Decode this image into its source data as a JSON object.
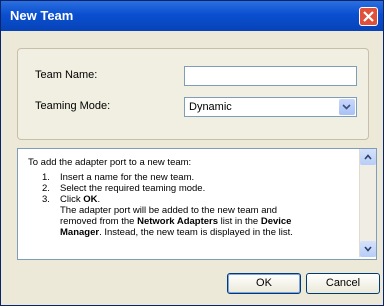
{
  "window": {
    "title": "New Team"
  },
  "form": {
    "team_name_label": "Team Name:",
    "team_name_value": "",
    "teaming_mode_label": "Teaming Mode:",
    "teaming_mode_value": "Dynamic"
  },
  "info": {
    "intro": "To add the adapter port to a new team:",
    "steps": [
      {
        "num": "1.",
        "text": "Insert a name for the new team."
      },
      {
        "num": "2.",
        "text": "Select the required teaming mode."
      },
      {
        "num": "3.",
        "text_prefix": "Click ",
        "bold": "OK",
        "text_suffix": "."
      }
    ],
    "para_1": "The adapter port will be added to the new team and",
    "para_2": "removed from the ",
    "para_bold_1": "Network Adapters",
    "para_3": " list in the ",
    "para_bold_2": "Device",
    "para_bold_3": "Manager",
    "para_4": ". Instead, the new team is displayed in the list."
  },
  "buttons": {
    "ok": "OK",
    "cancel": "Cancel"
  },
  "icons": {
    "close": "close-icon",
    "dropdown": "chevron-down-icon",
    "scroll_up": "scroll-up-icon",
    "scroll_down": "scroll-down-icon"
  }
}
